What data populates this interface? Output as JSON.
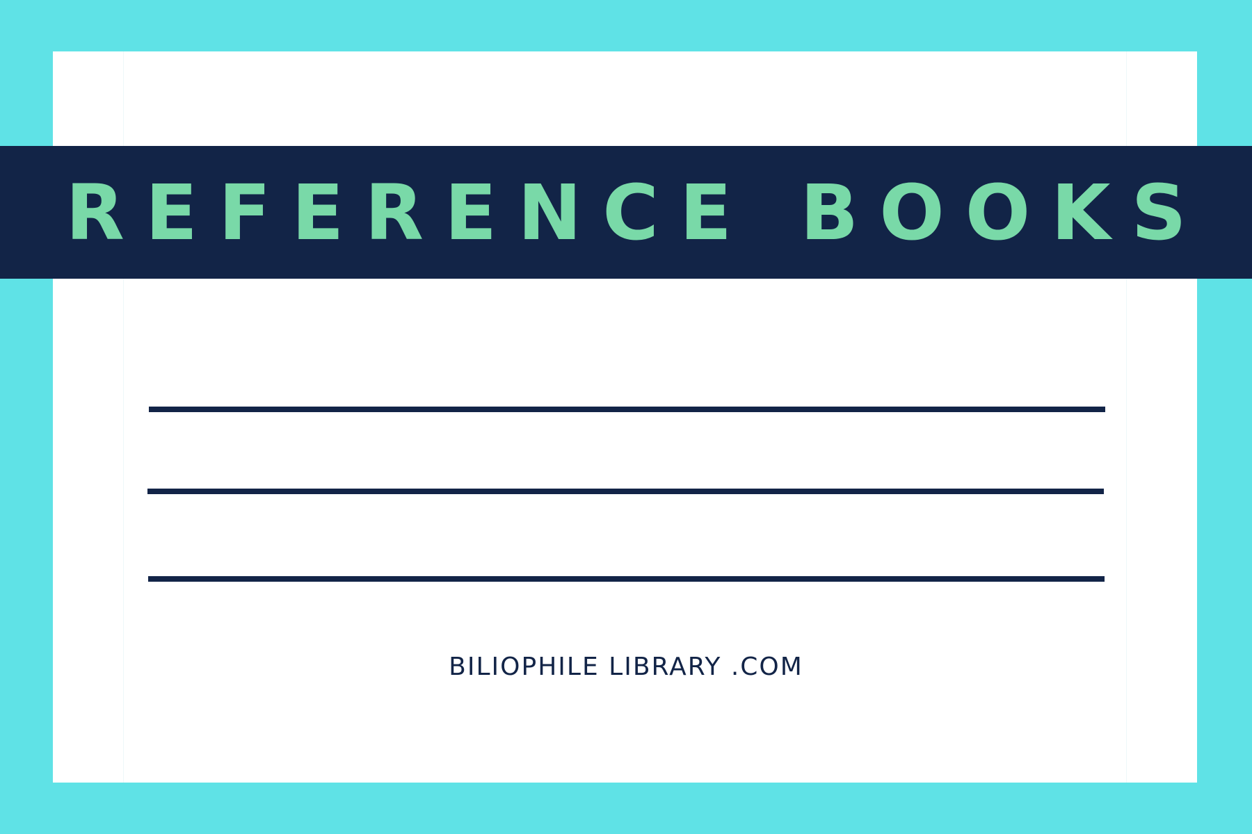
{
  "banner": {
    "title": "REFERENCE BOOKS"
  },
  "footer": {
    "text": "BILIOPHILE LIBRARY .COM"
  },
  "colors": {
    "border": "#5fe2e6",
    "card": "#ffffff",
    "banner": "#122447",
    "title": "#79d9a8",
    "lines": "#122447"
  }
}
